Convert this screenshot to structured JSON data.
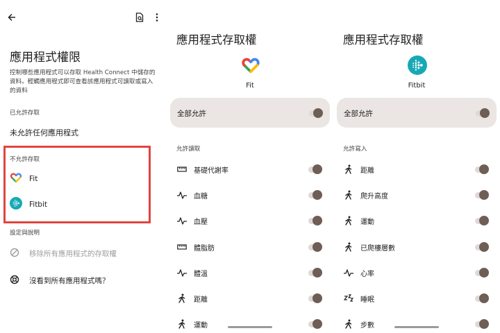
{
  "screen1": {
    "title": "應用程式權限",
    "description": "控制哪些應用程式可以存取 Health Connect 中儲存的資料。輕觸應用程式即可查看該應用程式可讀取或寫入的資料",
    "allowed_section_label": "已允許存取",
    "no_apps_text": "未允許任何應用程式",
    "not_allowed_section_label": "不允許存取",
    "apps": [
      {
        "name": "Fit",
        "icon": "google-fit-icon"
      },
      {
        "name": "Fitbit",
        "icon": "fitbit-icon"
      }
    ],
    "settings_section_label": "設定與說明",
    "remove_access_label": "移除所有應用程式的存取權",
    "cant_see_apps_label": "沒看到所有應用程式嗎？"
  },
  "screen2": {
    "title": "應用程式存取權",
    "app_name": "Fit",
    "allow_all_label": "全部允許",
    "group_label": "允許讀取",
    "permissions": [
      {
        "label": "基礎代謝率",
        "icon": "ruler-icon"
      },
      {
        "label": "血糖",
        "icon": "vitals-icon"
      },
      {
        "label": "血壓",
        "icon": "vitals-icon"
      },
      {
        "label": "體脂肪",
        "icon": "ruler-icon"
      },
      {
        "label": "體溫",
        "icon": "vitals-icon"
      },
      {
        "label": "距離",
        "icon": "walking-icon"
      },
      {
        "label": "運動",
        "icon": "walking-icon"
      }
    ]
  },
  "screen3": {
    "title": "應用程式存取權",
    "app_name": "Fitbit",
    "allow_all_label": "全部允許",
    "group_label": "允許寫入",
    "permissions": [
      {
        "label": "距離",
        "icon": "walking-icon"
      },
      {
        "label": "爬升高度",
        "icon": "walking-icon"
      },
      {
        "label": "運動",
        "icon": "walking-icon"
      },
      {
        "label": "已爬樓層數",
        "icon": "walking-icon"
      },
      {
        "label": "心率",
        "icon": "vitals-icon"
      },
      {
        "label": "睡眠",
        "icon": "sleep-icon"
      },
      {
        "label": "步數",
        "icon": "walking-icon"
      }
    ]
  },
  "colors": {
    "highlight_border": "#e0453f",
    "card_bg": "#ebe6e3",
    "toggle_thumb": "#6f5e55",
    "fitbit_teal": "#16a9b5"
  }
}
